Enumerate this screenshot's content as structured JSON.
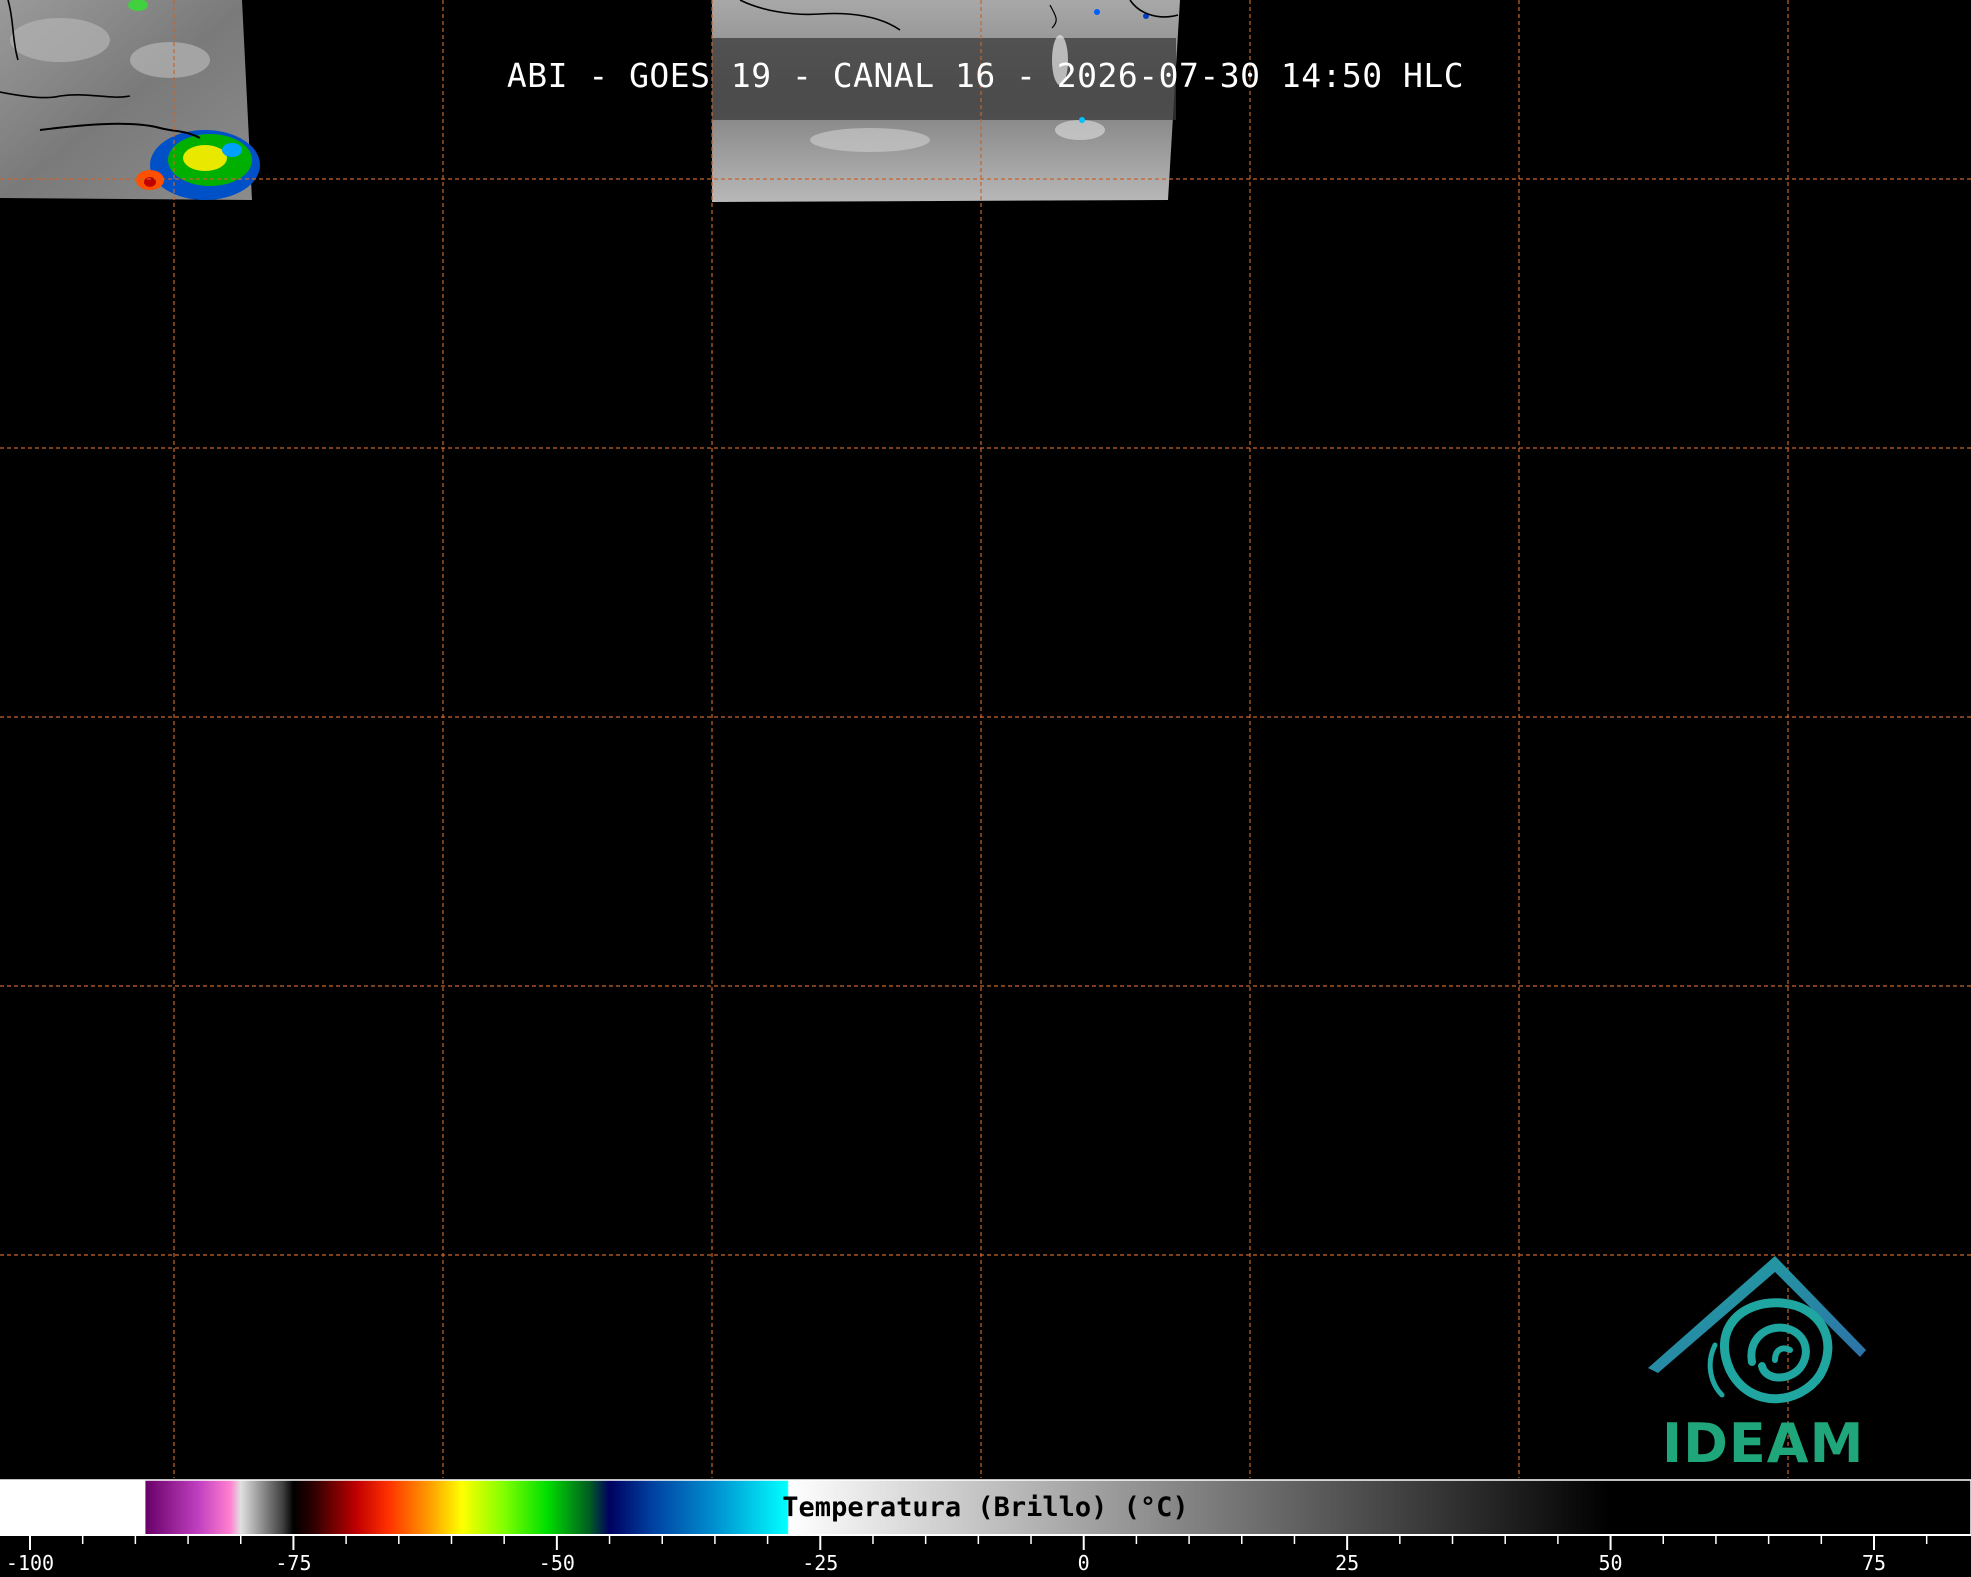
{
  "title": "ABI - GOES 19 - CANAL 16 - 2026-07-30 14:50 HLC",
  "logo": {
    "text": "IDEAM",
    "text_color": "#1fa67a",
    "roof_color": "#2e6fa8",
    "swirl_color": "#1fa6a0"
  },
  "grid": {
    "color": "#c8642a",
    "style": "dashed"
  },
  "colorbar": {
    "title": "Temperatura (Brillo) (°C)",
    "min": -100,
    "max": 85,
    "tick_labels": [
      "-100",
      "-75",
      "-50",
      "-25",
      "0",
      "25",
      "50",
      "75"
    ],
    "tick_values": [
      -100,
      -75,
      -50,
      -25,
      0,
      25,
      50,
      75
    ],
    "minor_step": 5,
    "stops": [
      {
        "v": -100,
        "c": "#ffffff"
      },
      {
        "v": -89.1,
        "c": "#ffffff"
      },
      {
        "v": -89,
        "c": "#6a006a"
      },
      {
        "v": -84,
        "c": "#c040c0"
      },
      {
        "v": -81,
        "c": "#ff80d0"
      },
      {
        "v": -80,
        "c": "#e0e0e0"
      },
      {
        "v": -76,
        "c": "#404040"
      },
      {
        "v": -75,
        "c": "#000000"
      },
      {
        "v": -73,
        "c": "#300000"
      },
      {
        "v": -69,
        "c": "#c00000"
      },
      {
        "v": -66,
        "c": "#ff3000"
      },
      {
        "v": -62,
        "c": "#ffa000"
      },
      {
        "v": -59,
        "c": "#ffff00"
      },
      {
        "v": -55,
        "c": "#80ff00"
      },
      {
        "v": -51,
        "c": "#00e000"
      },
      {
        "v": -47,
        "c": "#006020"
      },
      {
        "v": -45,
        "c": "#000060"
      },
      {
        "v": -41,
        "c": "#0040a0"
      },
      {
        "v": -35,
        "c": "#0090d0"
      },
      {
        "v": -28.1,
        "c": "#00ffff"
      },
      {
        "v": -28,
        "c": "#ffffff"
      },
      {
        "v": 50,
        "c": "#000000"
      },
      {
        "v": 85,
        "c": "#000000"
      }
    ]
  },
  "imagery": {
    "left_patch": {
      "palette": [
        "#8a8a8a",
        "#b0b0b0",
        "#00c000",
        "#ffff00",
        "#ff4000",
        "#0040c0",
        "#00a0ff"
      ]
    },
    "right_patch": {
      "palette": [
        "#707070",
        "#9a9a9a",
        "#c8c8c8",
        "#404040"
      ]
    },
    "coastline_color": "#000000"
  }
}
